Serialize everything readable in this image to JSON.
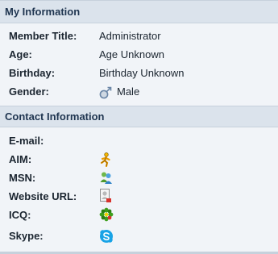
{
  "sections": {
    "my_information": {
      "title": "My Information",
      "rows": {
        "member_title": {
          "label": "Member Title:",
          "value": "Administrator"
        },
        "age": {
          "label": "Age:",
          "value": "Age Unknown"
        },
        "birthday": {
          "label": "Birthday:",
          "value": "Birthday Unknown"
        },
        "gender": {
          "label": "Gender:",
          "value": "Male",
          "icon": "gender-male-icon"
        }
      }
    },
    "contact_information": {
      "title": "Contact Information",
      "rows": {
        "email": {
          "label": "E-mail:"
        },
        "aim": {
          "label": "AIM:",
          "icon": "aim-icon"
        },
        "msn": {
          "label": "MSN:",
          "icon": "msn-icon"
        },
        "website": {
          "label": "Website URL:",
          "icon": "website-icon"
        },
        "icq": {
          "label": "ICQ:",
          "icon": "icq-icon"
        },
        "skype": {
          "label": "Skype:",
          "icon": "skype-icon"
        }
      }
    }
  },
  "colors": {
    "background": "#f1f4f8",
    "header_background": "#dbe3ec",
    "header_text": "#1f3550"
  }
}
